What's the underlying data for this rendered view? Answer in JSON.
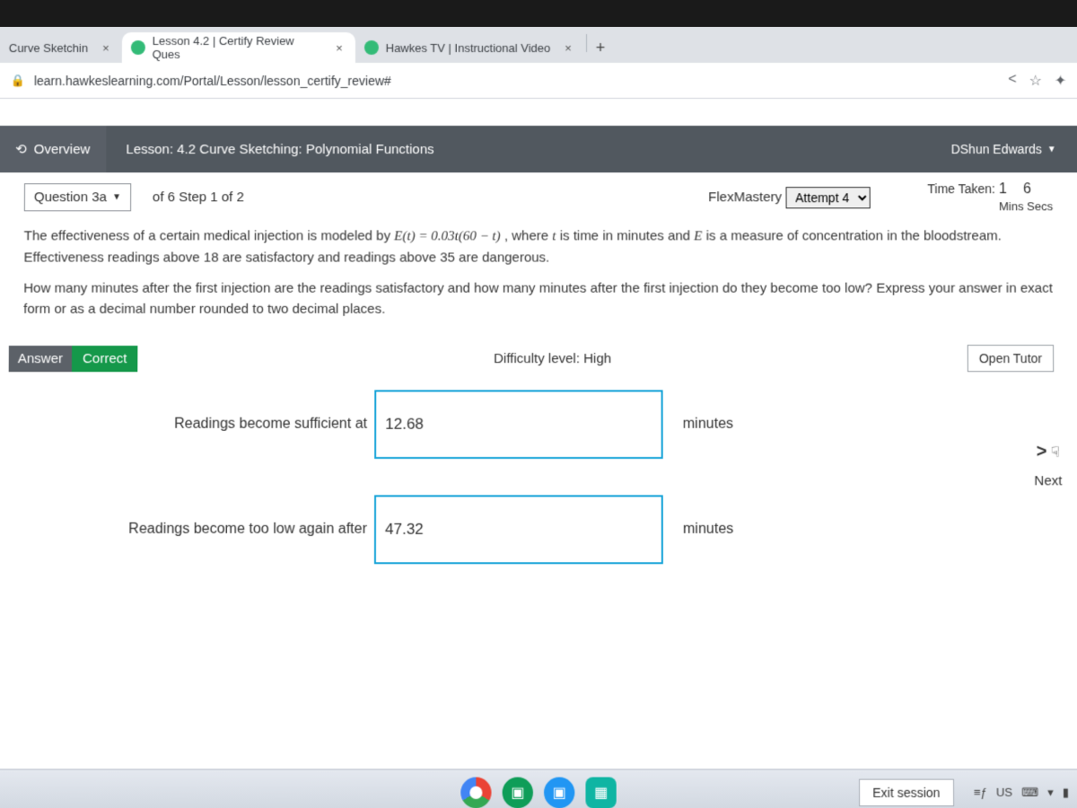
{
  "tabs": [
    {
      "title": "Curve Sketchin",
      "active": false
    },
    {
      "title": "Lesson 4.2 | Certify Review Ques",
      "active": true
    },
    {
      "title": "Hawkes TV | Instructional Video",
      "active": false
    }
  ],
  "newtab": "+",
  "url": "learn.hawkeslearning.com/Portal/Lesson/lesson_certify_review#",
  "toolbar": {
    "share": "<",
    "star": "☆",
    "ext": "✦",
    "chevron": "⌄"
  },
  "overview_label": "Overview",
  "overview_icon": "⟲",
  "lesson_title": "Lesson: 4.2 Curve Sketching: Polynomial Functions",
  "user_name": "DShun Edwards",
  "question": {
    "label": "Question 3a",
    "step": "of 6 Step 1 of 2"
  },
  "flexmastery_label": "FlexMastery",
  "attempt_label": "Attempt 4",
  "time_taken_label": "Time Taken:",
  "time": {
    "mins": "1",
    "secs": "6",
    "mins_label": "Mins",
    "secs_label": "Secs"
  },
  "stem": {
    "p1a": "The effectiveness of a certain medical injection is modeled by ",
    "p1_math": "E(t) = 0.03t(60 − t)",
    "p1b": ", where ",
    "p1_var": "t",
    "p1c": " is time in minutes and ",
    "p1_var2": "E",
    "p1d": " is a measure of concentration in the bloodstream. Effectiveness readings above 18 are satisfactory and readings above 35 are dangerous.",
    "p2": "How many minutes after the first injection are the readings satisfactory and how many minutes after the first injection do they become too low? Express your answer in exact form or as a decimal number rounded to two decimal places."
  },
  "answer_label": "Answer",
  "correct_label": "Correct",
  "difficulty": "Difficulty level: High",
  "open_tutor": "Open Tutor",
  "rows": [
    {
      "label": "Readings become sufficient at",
      "value": "12.68",
      "unit": "minutes"
    },
    {
      "label": "Readings become too low again after",
      "value": "47.32",
      "unit": "minutes"
    }
  ],
  "next": {
    "arrow": ">",
    "hand": "☟",
    "label": "Next"
  },
  "exit_label": "Exit session",
  "tray": {
    "kb": "≡ƒ",
    "lang": "US",
    "ime": "⌨",
    "wifi": "▾",
    "batt": "▮"
  }
}
